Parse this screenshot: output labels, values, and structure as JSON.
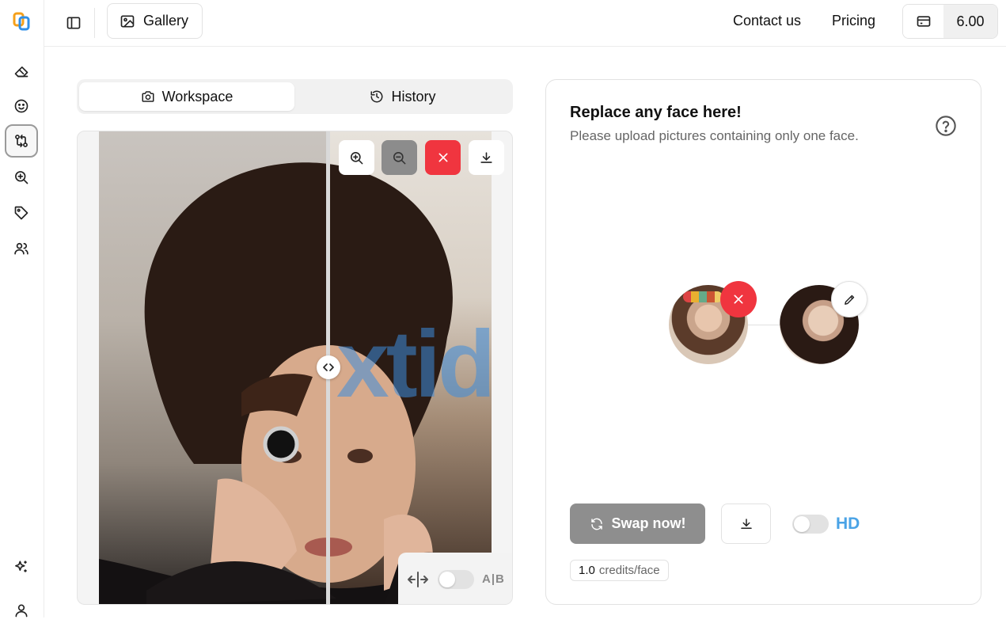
{
  "header": {
    "gallery_label": "Gallery",
    "nav": [
      {
        "label": "Contact us"
      },
      {
        "label": "Pricing"
      }
    ],
    "credits_value": "6.00"
  },
  "rail": {
    "items": [
      {
        "name": "eraser",
        "active": false
      },
      {
        "name": "face-retouch",
        "active": false
      },
      {
        "name": "face-swap",
        "active": true
      },
      {
        "name": "enhance",
        "active": false
      },
      {
        "name": "tag",
        "active": false
      },
      {
        "name": "users",
        "active": false
      }
    ]
  },
  "tabs": [
    {
      "label": "Workspace",
      "active": true
    },
    {
      "label": "History",
      "active": false
    }
  ],
  "viewer": {
    "watermark": "xtid",
    "compare_label": "A|B"
  },
  "panel": {
    "title": "Replace any face here!",
    "subtitle": "Please upload pictures containing only one face.",
    "swap_label": "Swap now!",
    "hd_label": "HD",
    "credit_amount": "1.0",
    "credit_unit": "credits/face"
  },
  "colors": {
    "danger": "#f0353f",
    "hd_blue": "#4aa3e6",
    "disabled_gray": "#8e8e8e"
  }
}
